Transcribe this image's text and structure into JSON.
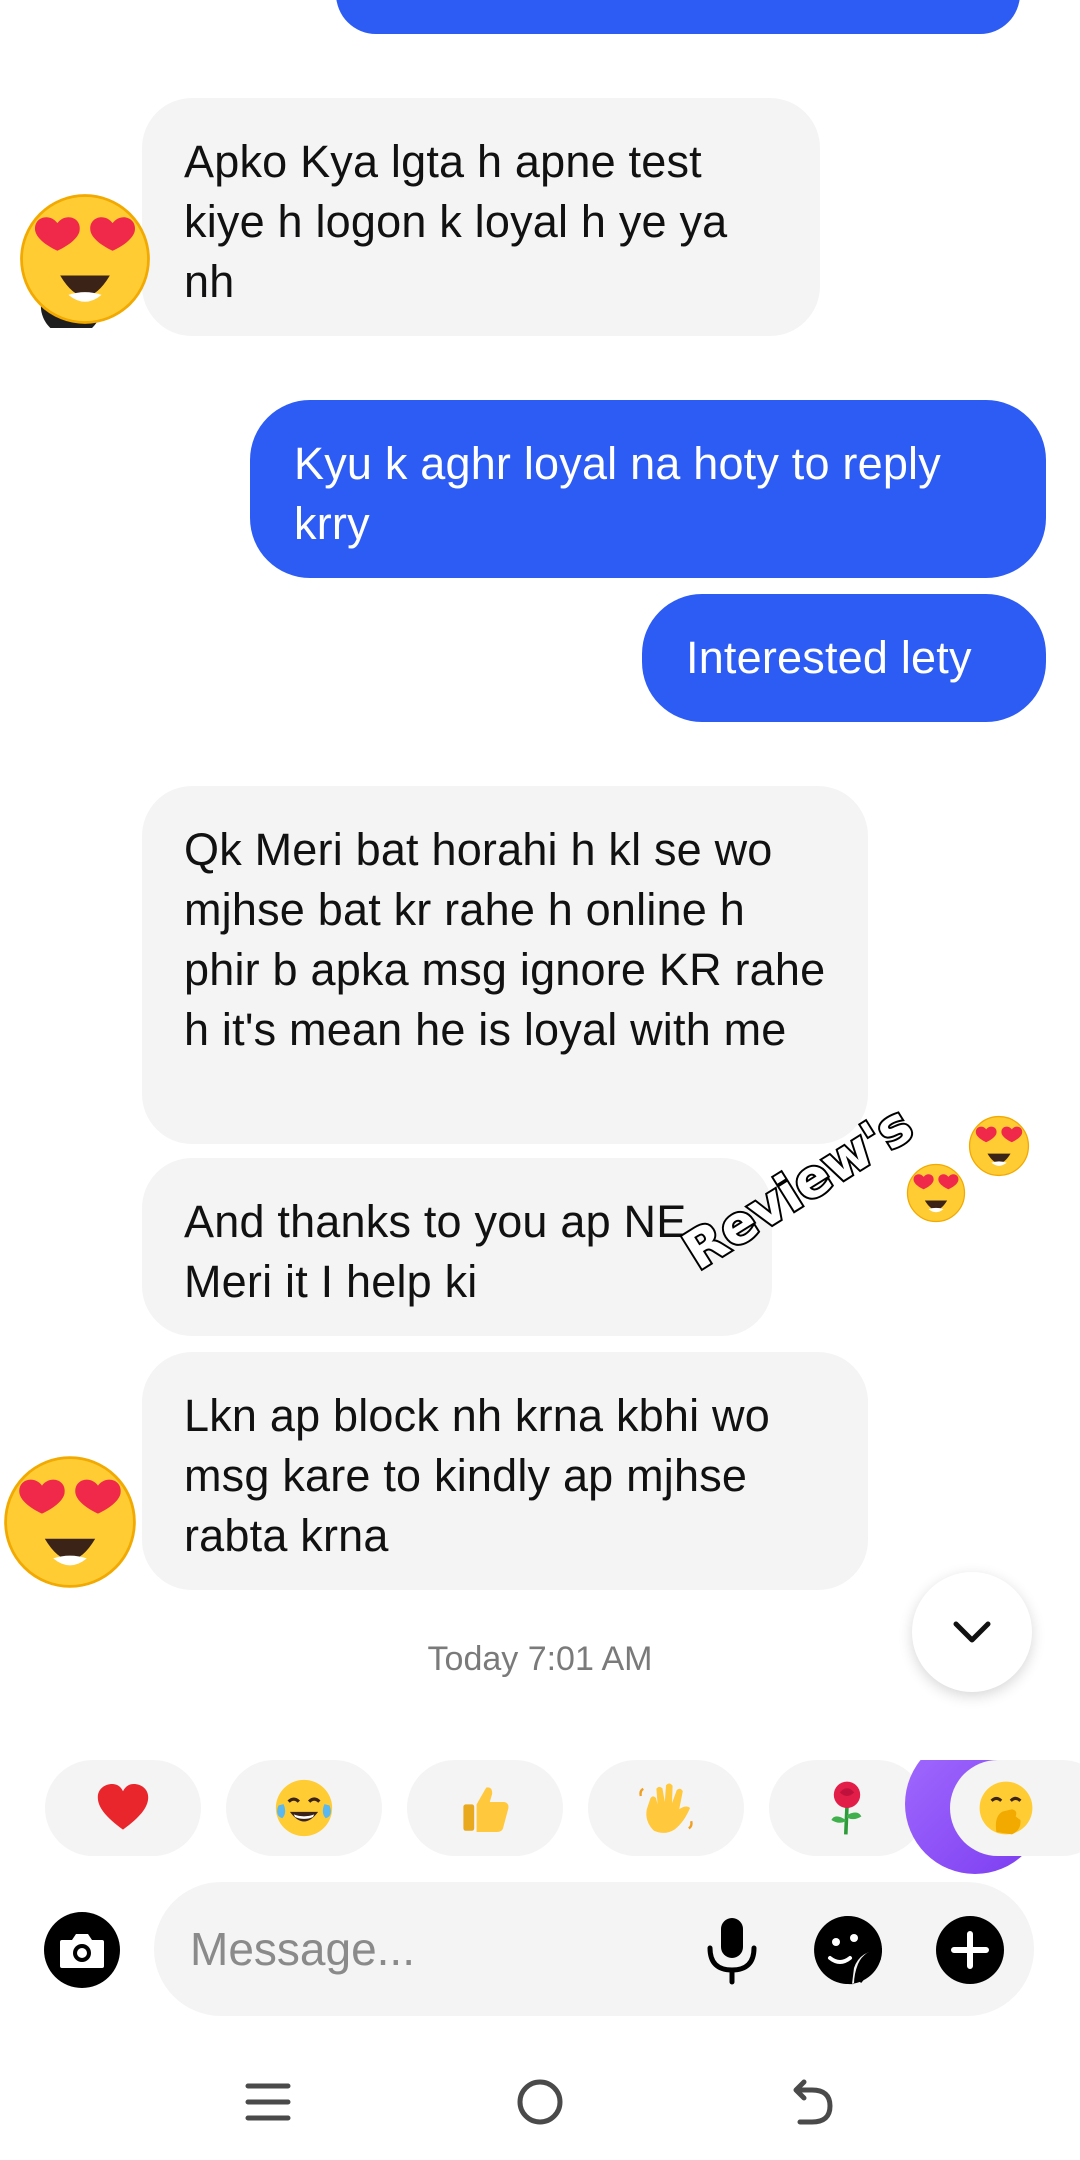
{
  "messages": [
    {
      "id": "m1",
      "direction": "incoming",
      "text": "Apko Kya lgta h apne test kiye h logon k loyal h ye ya nh"
    },
    {
      "id": "m2",
      "direction": "outgoing",
      "text": "Kyu k aghr loyal na hoty to reply krry"
    },
    {
      "id": "m3",
      "direction": "outgoing",
      "text": "Interested lety"
    },
    {
      "id": "m4",
      "direction": "incoming",
      "text": "Qk Meri bat horahi h kl se wo mjhse bat kr rahe h online h phir b apka msg ignore KR rahe h it's mean he is loyal with me"
    },
    {
      "id": "m5",
      "direction": "incoming",
      "text": "And thanks to you ap NE Meri it I help ki"
    },
    {
      "id": "m6",
      "direction": "incoming",
      "text": "Lkn ap block nh krna kbhi wo msg kare to kindly ap mjhse rabta krna"
    }
  ],
  "overlay": {
    "sticker_text": "Review's",
    "emoji": "heart-eyes"
  },
  "timestamp": "Today 7:01 AM",
  "quick_reactions": [
    "heart",
    "tears-of-joy",
    "thumbs-up",
    "waving-hand",
    "rose",
    "ai-assistant",
    "hand-over-mouth"
  ],
  "composer": {
    "placeholder": "Message..."
  },
  "icons": {
    "camera": "camera-icon",
    "mic": "microphone-icon",
    "sticker": "sticker-icon",
    "plus": "plus-icon",
    "scroll_down": "chevron-down-icon",
    "nav_menu": "menu-icon",
    "nav_home": "home-icon",
    "nav_back": "back-icon"
  },
  "colors": {
    "outgoing_bubble": "#2d5cf5",
    "incoming_bubble": "#f4f4f5",
    "ai_gradient_start": "#a36bff",
    "ai_gradient_end": "#7b3cf0"
  }
}
